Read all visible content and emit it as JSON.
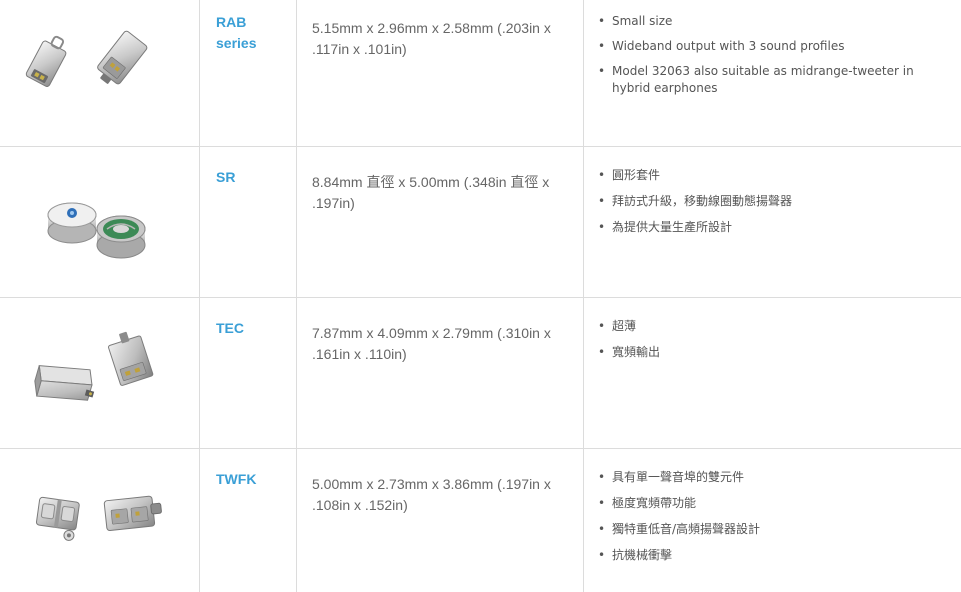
{
  "rows": [
    {
      "name_line1": "RAB",
      "name_line2": "series",
      "dimensions": "5.15mm x 2.96mm x 2.58mm (.203in x .117in x .101in)",
      "features": [
        "Small size",
        "Wideband output with 3 sound profiles",
        "Model 32063 also suitable as midrange-tweeter in hybrid earphones"
      ],
      "image": "rab-series-receiver-image"
    },
    {
      "name_line1": "SR",
      "dimensions": "8.84mm 直徑 x 5.00mm (.348in 直徑 x .197in)",
      "features": [
        "圓形套件",
        "拜訪式升級，移動線圈動態揚聲器",
        "為提供大量生產所設計"
      ],
      "image": "sr-round-speaker-image"
    },
    {
      "name_line1": "TEC",
      "dimensions": "7.87mm x 4.09mm x 2.79mm (.310in x .161in x .110in)",
      "features": [
        "超薄",
        "寬頻輸出"
      ],
      "image": "tec-receiver-image"
    },
    {
      "name_line1": "TWFK",
      "dimensions": "5.00mm x 2.73mm x 3.86mm (.197in x .108in x .152in)",
      "features": [
        "具有單一聲音埠的雙元件",
        "極度寬頻帶功能",
        "獨特重低音/高頻揚聲器設計",
        "抗機械衝擊"
      ],
      "image": "twfk-dual-receiver-image"
    }
  ],
  "colors": {
    "name": "#3a9fd6",
    "text": "#666666",
    "divider": "#dcdcdc"
  }
}
